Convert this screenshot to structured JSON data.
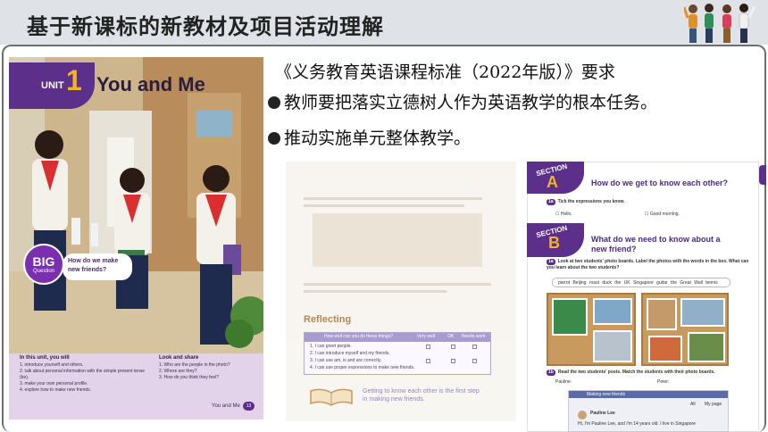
{
  "header": {
    "title": "基于新课标的新教材及项目活动理解"
  },
  "requirements": {
    "heading": "《义务教育英语课程标准（2022年版）》要求",
    "items": [
      "教师要把落实立德树人作为英语教学的根本任务。",
      "推动实施单元整体教学。"
    ]
  },
  "cover": {
    "unit_word": "UNIT",
    "unit_number": "1",
    "unit_title": "You and Me",
    "big_label": "BIG",
    "question_label": "Question",
    "big_question": "How do we make new friends?",
    "in_this_unit_heading": "In this unit, you will",
    "in_this_unit_items": [
      "1. introduce yourself and others.",
      "2. talk about personal information with the simple present tense (be).",
      "3. make your own personal profile.",
      "4. explore how to make new friends."
    ],
    "look_share_heading": "Look and share",
    "look_share_items": [
      "1. Who are the people in the photo?",
      "2. Where are they?",
      "3. How do you think they feel?"
    ],
    "footer": "You and Me",
    "page_number": "13"
  },
  "worksheet": {
    "reflecting_label": "Reflecting",
    "table_header": [
      "How well can you do these things?",
      "Very well",
      "OK",
      "Needs work"
    ],
    "table_rows": [
      "1. I can greet people.",
      "2. I can introduce myself and my friends.",
      "3. I can use am, is and are correctly.",
      "4. I can use proper expressions to make new friends."
    ],
    "getting_text": "Getting to know each other is the first step in making new friends."
  },
  "section_page": {
    "section_word": "SECTION",
    "section_a_letter": "A",
    "section_a_question": "How do we get to know each other?",
    "ex_1a_num": "1a",
    "ex_1a_text": "Tick the expressions you know.",
    "ex_1a_items": [
      "Hello.",
      "Good morning."
    ],
    "section_b_letter": "B",
    "section_b_question": "What do we need to know about a new friend?",
    "ex_1a_b_text": "Look at two students' photo boards. Label the photos with the words in the box. What can you learn about the two students?",
    "word_box": "parrot   Beijing roast duck   the UK   Singapore   guitar   the Great Wall   tennis",
    "ex_1b_num": "1b",
    "ex_1b_text": "Read the two students' posts. Match the students with their photo boards.",
    "pauline_label": "Pauline:",
    "peter_label": "Peter:",
    "social_title": "Making new friends",
    "social_tabs": [
      "All",
      "My page"
    ],
    "post_name": "Pauline Lee",
    "post_text": "Hi, I'm Pauline Lee, and I'm 14 years old. I live in Singapore"
  },
  "colors": {
    "title_bar": "#dfe2e6",
    "purple": "#5b2f8a",
    "gold": "#f0b429"
  }
}
